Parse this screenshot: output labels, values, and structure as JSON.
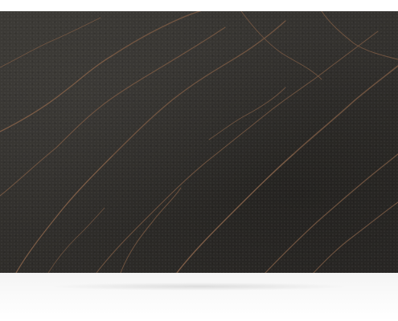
{
  "image": {
    "subject": "quartz-slab",
    "colors": {
      "background": "#ffffff",
      "slab_base": "#34322f",
      "vein": "#7a5a44",
      "vein_highlight": "#9a7358"
    }
  }
}
